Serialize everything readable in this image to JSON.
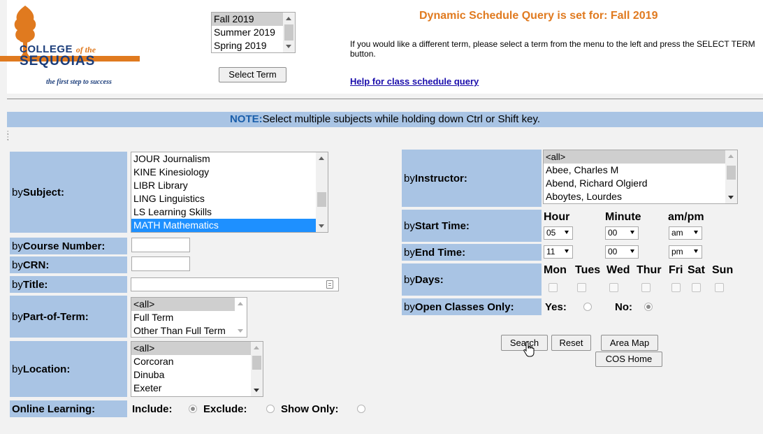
{
  "header": {
    "logo": {
      "college": "COLLEGE",
      "of_the": "of the",
      "sequoias": "SEQUOIAS",
      "tagline": "the first step to success"
    },
    "terms": [
      "Fall 2019",
      "Summer 2019",
      "Spring 2019"
    ],
    "select_term_button": "Select Term",
    "title": "Dynamic Schedule Query is set for: Fall 2019",
    "info": "If you would like a different term, please select a term from the menu to the left and press the SELECT TERM button.",
    "help_link": "Help for class schedule query"
  },
  "note": {
    "label": "NOTE:",
    "text": "Select multiple subjects while holding down Ctrl or Shift key."
  },
  "semicolons": ";",
  "left": {
    "subject": {
      "by": "by ",
      "label": "Subject:",
      "options": [
        "JOUR Journalism",
        "KINE Kinesiology",
        "LIBR Library",
        "LING Linguistics",
        "LS Learning Skills",
        "MATH Mathematics"
      ],
      "selected": "MATH Mathematics"
    },
    "course_number": {
      "by": "by ",
      "label": "Course Number:",
      "value": ""
    },
    "crn": {
      "by": "by ",
      "label": "CRN:",
      "value": ""
    },
    "title": {
      "by": "by ",
      "label": "Title:",
      "value": ""
    },
    "part_of_term": {
      "by": "by ",
      "label": "Part-of-Term:",
      "options": [
        "<all>",
        "Full Term",
        "Other Than Full Term"
      ]
    },
    "location": {
      "by": "by ",
      "label": "Location:",
      "options": [
        "<all>",
        "Corcoran",
        "Dinuba",
        "Exeter"
      ]
    },
    "online": {
      "label": "Online Learning:",
      "include": "Include:",
      "exclude": "Exclude:",
      "show_only": "Show Only:",
      "selected": "include"
    }
  },
  "right": {
    "instructor": {
      "by": "by ",
      "label": "Instructor:",
      "options": [
        "<all>",
        "Abee, Charles M",
        "Abend, Richard Olgierd",
        "Aboytes, Lourdes"
      ]
    },
    "start_time": {
      "by": "by ",
      "label": "Start Time:",
      "hour_header": "Hour",
      "minute_header": "Minute",
      "ampm_header": "am/pm",
      "hour": "05",
      "minute": "00",
      "ampm": "am"
    },
    "end_time": {
      "by": "by ",
      "label": "End Time:",
      "hour": "11",
      "minute": "00",
      "ampm": "pm"
    },
    "days": {
      "by": "by ",
      "label": "Days:",
      "names": [
        "Mon",
        "Tues",
        "Wed",
        "Thur",
        "Fri",
        "Sat",
        "Sun"
      ]
    },
    "open_classes": {
      "by": "by ",
      "label": "Open Classes Only:",
      "yes": "Yes:",
      "no": "No:",
      "selected": "no"
    }
  },
  "buttons": {
    "search": "Search",
    "reset": "Reset",
    "area_map": "Area Map",
    "cos_home": "COS Home"
  },
  "colors": {
    "label_bg": "#a9c4e4",
    "accent_orange": "#e07a1f",
    "link_blue": "#1a0dab",
    "selected_blue": "#1e90ff"
  }
}
